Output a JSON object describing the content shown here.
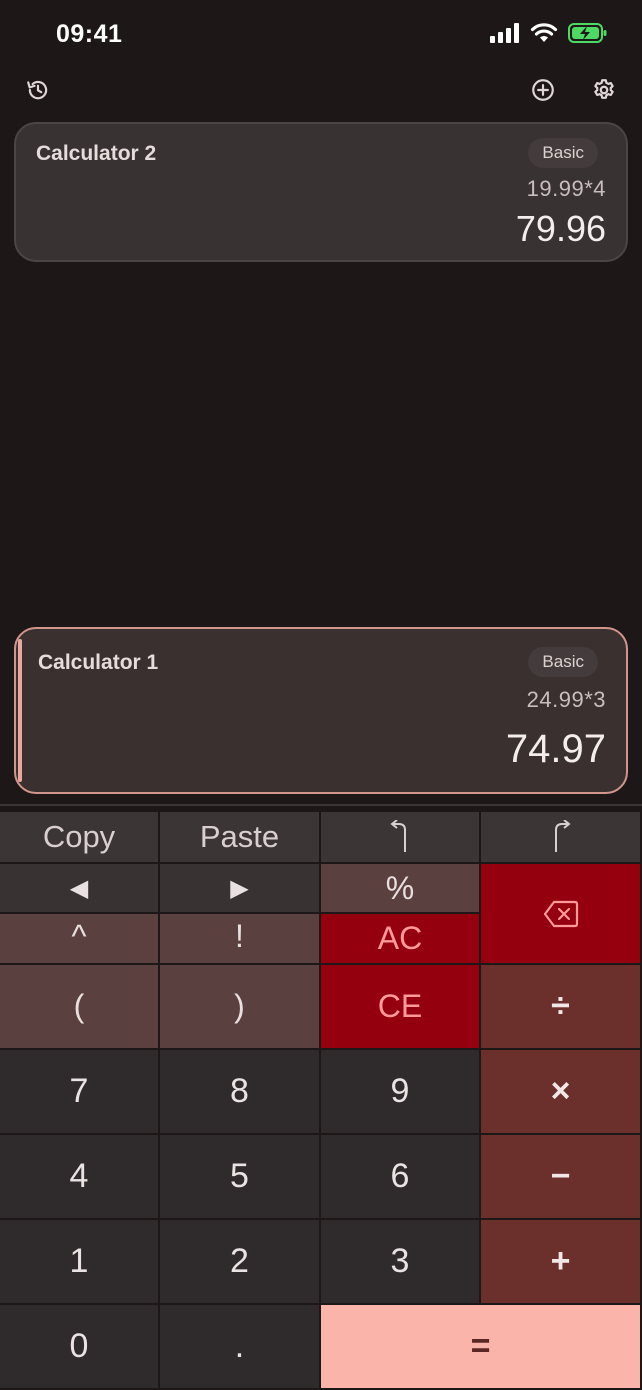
{
  "status_bar": {
    "time": "09:41"
  },
  "toolbar": {
    "history_icon": "history-icon",
    "add_icon": "add-circle-icon",
    "settings_icon": "gear-icon"
  },
  "calculators": [
    {
      "name": "Calculator 2",
      "mode": "Basic",
      "expression": "19.99*4",
      "result": "79.96",
      "active": false
    },
    {
      "name": "Calculator 1",
      "mode": "Basic",
      "expression": "24.99*3",
      "result": "74.97",
      "active": true
    }
  ],
  "keypad": {
    "copy": "Copy",
    "paste": "Paste",
    "undo_icon": "undo-icon",
    "redo_icon": "redo-icon",
    "cursor_left": "◀",
    "cursor_right": "▶",
    "percent": "%",
    "backspace_icon": "backspace-icon",
    "power": "^",
    "factorial": "!",
    "all_clear": "AC",
    "open_paren": "(",
    "close_paren": ")",
    "clear_entry": "CE",
    "divide": "÷",
    "multiply": "×",
    "minus": "−",
    "plus": "+",
    "equals": "=",
    "decimal": ".",
    "digits": {
      "d0": "0",
      "d1": "1",
      "d2": "2",
      "d3": "3",
      "d4": "4",
      "d5": "5",
      "d6": "6",
      "d7": "7",
      "d8": "8",
      "d9": "9"
    }
  },
  "colors": {
    "background": "#1d1718",
    "accent": "#fbb4a9",
    "danger": "#94000e",
    "operator": "#6b2f2c",
    "battery": "#4cd964"
  }
}
